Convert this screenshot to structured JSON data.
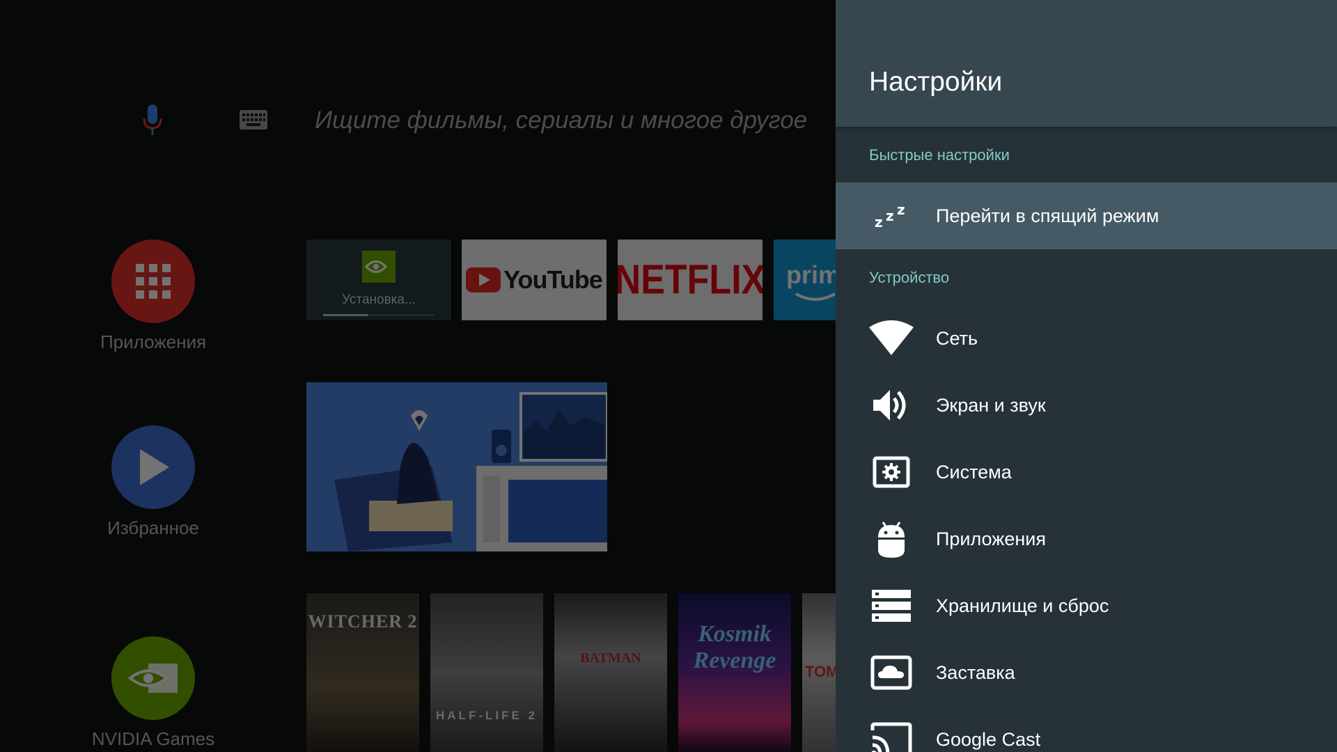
{
  "launcher": {
    "search": {
      "placeholder": "Ищите фильмы, сериалы и многое другое"
    },
    "side_apps": [
      {
        "label": "Приложения"
      },
      {
        "label": "Избранное"
      },
      {
        "label": "NVIDIA Games"
      }
    ],
    "tiles": {
      "install": {
        "logo_text": "NVIDIA GAMES",
        "label": "Установка...",
        "progress": 0.4
      },
      "youtube": {
        "word": "YouTube"
      },
      "netflix": {
        "word": "NETFLIX"
      },
      "prime": {
        "word": "prim"
      }
    },
    "games": [
      {
        "title": "WITCHER 2"
      },
      {
        "title": "HALF-LIFE 2"
      },
      {
        "title": "BATMAN"
      },
      {
        "title": "Kosmik Revenge"
      },
      {
        "title": "TOM"
      }
    ]
  },
  "settings": {
    "title": "Настройки",
    "sections": {
      "quick": "Быстрые настройки",
      "device": "Устройство"
    },
    "items": [
      {
        "label": "Перейти в спящий режим",
        "icon": "sleep-icon"
      },
      {
        "label": "Сеть",
        "icon": "wifi-icon"
      },
      {
        "label": "Экран и звук",
        "icon": "volume-icon"
      },
      {
        "label": "Система",
        "icon": "system-gear-icon"
      },
      {
        "label": "Приложения",
        "icon": "android-icon"
      },
      {
        "label": "Хранилище и сброс",
        "icon": "storage-icon"
      },
      {
        "label": "Заставка",
        "icon": "screensaver-icon"
      },
      {
        "label": "Google Cast",
        "icon": "cast-icon"
      }
    ]
  },
  "colors": {
    "panel_bg": "#263238",
    "panel_header": "#37474f",
    "focused_row": "#455a64",
    "section_accent": "#80cbc4"
  }
}
